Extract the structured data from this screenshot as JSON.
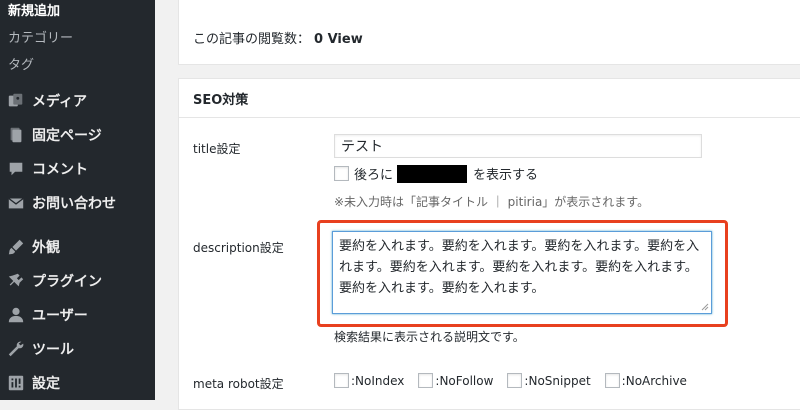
{
  "sidebar": {
    "subitems": [
      {
        "label": "新規追加",
        "current": true
      },
      {
        "label": "カテゴリー",
        "current": false
      },
      {
        "label": "タグ",
        "current": false
      }
    ],
    "items": [
      {
        "label": "メディア",
        "icon": "media-icon"
      },
      {
        "label": "固定ページ",
        "icon": "page-icon"
      },
      {
        "label": "コメント",
        "icon": "comment-icon"
      },
      {
        "label": "お問い合わせ",
        "icon": "mail-icon"
      },
      {
        "label": "外観",
        "icon": "brush-icon"
      },
      {
        "label": "プラグイン",
        "icon": "plugin-icon"
      },
      {
        "label": "ユーザー",
        "icon": "user-icon"
      },
      {
        "label": "ツール",
        "icon": "wrench-icon"
      },
      {
        "label": "設定",
        "icon": "settings-icon"
      }
    ]
  },
  "views": {
    "label": "この記事の閲覧数：",
    "value": "0 View"
  },
  "seo": {
    "title": "SEO対策",
    "title_setting": {
      "label": "title設定",
      "value": "テスト",
      "append_prefix": "後ろに",
      "append_suffix": "を表示する",
      "hint": "※未入力時は「記事タイトル ｜ pitiria」が表示されます。"
    },
    "description_setting": {
      "label": "description設定",
      "value": "要約を入れます。要約を入れます。要約を入れます。要約を入れます。要約を入れます。要約を入れます。要約を入れます。要約を入れます。要約を入れます。",
      "help": "検索結果に表示される説明文です。"
    },
    "meta_robot": {
      "label": "meta robot設定",
      "options": [
        ":NoIndex",
        ":NoFollow",
        ":NoSnippet",
        ":NoArchive"
      ]
    }
  },
  "colors": {
    "sidebar_bg": "#23282d",
    "highlight": "#e8401f",
    "focus_border": "#5b9dd9"
  }
}
